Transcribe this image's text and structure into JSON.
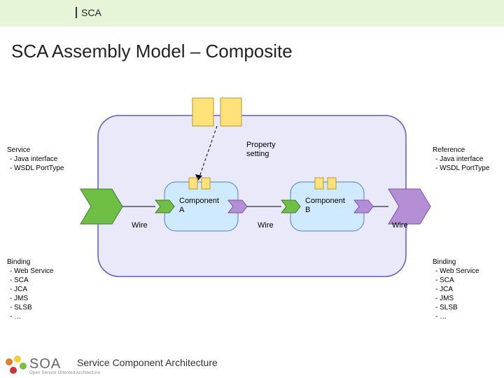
{
  "header": {
    "label": "SCA"
  },
  "title": "SCA Assembly Model – Composite",
  "diagram": {
    "composite_fill": "#e9e9fa",
    "composite_stroke": "#5b5bd6",
    "component_fill": "#cfe9ff",
    "component_stroke": "#4c7ecf",
    "property_block_fill": "#ffe27a",
    "property_block_stroke": "#b59a2b",
    "chevron_green": "#6fbf44",
    "chevron_purple": "#b58fd6",
    "property_setting_label": "Property\nsetting",
    "componentA_label": "Component\nA",
    "componentB_label": "Component\nB",
    "wire_label": "Wire"
  },
  "service": {
    "heading": "Service",
    "items": [
      "Java interface",
      "WSDL PortType"
    ]
  },
  "reference": {
    "heading": "Reference",
    "items": [
      "Java interface",
      "WSDL PortType"
    ]
  },
  "binding_left": {
    "heading": "Binding",
    "items": [
      "Web Service",
      "SCA",
      "JCA",
      "JMS",
      "SLSB",
      "…"
    ]
  },
  "binding_right": {
    "heading": "Binding",
    "items": [
      "Web Service",
      "SCA",
      "JCA",
      "JMS",
      "SLSB",
      "…"
    ]
  },
  "footer": {
    "text": "Service Component Architecture"
  },
  "logo": {
    "text": "SOA",
    "sub": "Open Service Oriented Architecture"
  }
}
